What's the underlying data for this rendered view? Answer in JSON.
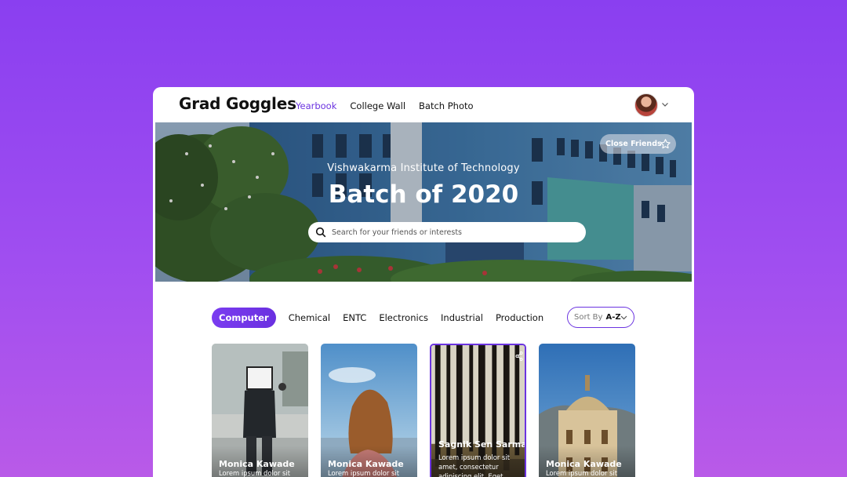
{
  "app": {
    "title": "Grad Goggles"
  },
  "nav": {
    "items": [
      {
        "label": "Yearbook",
        "active": true
      },
      {
        "label": "College Wall",
        "active": false
      },
      {
        "label": "Batch Photo",
        "active": false
      }
    ]
  },
  "user": {
    "avatar_icon": "user-avatar",
    "menu_icon": "chevron-down-icon"
  },
  "hero": {
    "institute": "Vishwakarma Institute of Technology",
    "title": "Batch of 2020",
    "search_placeholder": "Search for your friends or interests",
    "close_friends_label": "Close Friends"
  },
  "filters": {
    "tabs": [
      {
        "label": "Computer",
        "active": true
      },
      {
        "label": "Chemical",
        "active": false
      },
      {
        "label": "ENTC",
        "active": false
      },
      {
        "label": "Electronics",
        "active": false
      },
      {
        "label": "Industrial",
        "active": false
      },
      {
        "label": "Production",
        "active": false
      }
    ],
    "sort_prefix": "Sort By",
    "sort_value": "A-Z"
  },
  "cards": [
    {
      "name": "Monica Kawade",
      "desc": "Lorem ipsum dolor sit"
    },
    {
      "name": "Monica Kawade",
      "desc": "Lorem ipsum dolor sit"
    },
    {
      "name": "Sagnik Sen Sarma",
      "desc": "Lorem ipsum dolor sit amet, consectetur adipiscing elit. Eget dignissim sit at a feugiat"
    },
    {
      "name": "Monica Kawade",
      "desc": "Lorem ipsum dolor sit"
    }
  ],
  "colors": {
    "accent": "#6b34e0",
    "background_top": "#8a3ff0",
    "background_bottom": "#b95ae8"
  }
}
